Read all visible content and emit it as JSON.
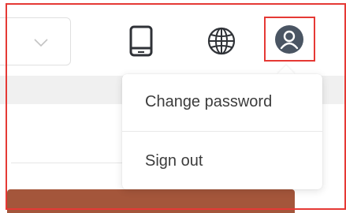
{
  "header": {
    "select": {
      "icon": "chevron-down-icon",
      "value": ""
    },
    "icons": [
      {
        "name": "tablet-icon",
        "color": "#2f3237"
      },
      {
        "name": "globe-icon",
        "color": "#2f3237"
      },
      {
        "name": "user-icon",
        "color": "#4a5563"
      }
    ]
  },
  "user_menu": {
    "items": [
      {
        "label": "Change password"
      },
      {
        "label": "Sign out"
      }
    ]
  },
  "colors": {
    "highlight_outline": "#e53935",
    "bottom_bar": "#a4563b",
    "band": "#f0f0f0",
    "text": "#3c3c3c"
  }
}
